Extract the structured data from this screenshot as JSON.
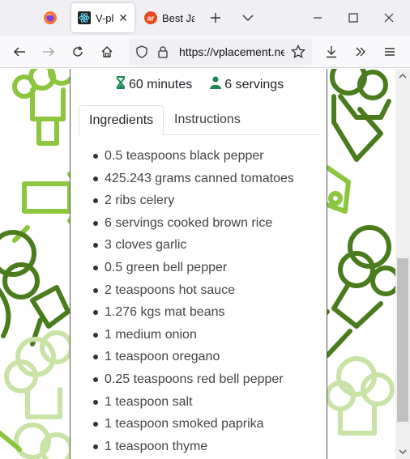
{
  "browser": {
    "tabs": [
      {
        "label": "V-pl",
        "favicon": "react-icon",
        "active": true
      },
      {
        "label": "Best Ja",
        "favicon": "ar-icon",
        "active": false
      }
    ],
    "url": "https://vplacement.ne"
  },
  "recipe": {
    "time": "60 minutes",
    "servings": "6 servings",
    "tabs": {
      "ingredients": "Ingredients",
      "instructions": "Instructions"
    },
    "ingredients": [
      "0.5 teaspoons black pepper",
      "425.243 grams canned tomatoes",
      "2 ribs celery",
      "6 servings cooked brown rice",
      "3 cloves garlic",
      "0.5 green bell pepper",
      "2 teaspoons hot sauce",
      "1.276 kgs mat beans",
      "1 medium onion",
      "1 teaspoon oregano",
      "0.25 teaspoons red bell pepper",
      "1 teaspoon salt",
      "1 teaspoon smoked paprika",
      "1 teaspoon thyme"
    ]
  },
  "colors": {
    "accent_green": "#198754",
    "veg_dark": "#4a7c1e",
    "veg_light": "#8cc63f",
    "veg_pale": "#c9e2a6"
  }
}
